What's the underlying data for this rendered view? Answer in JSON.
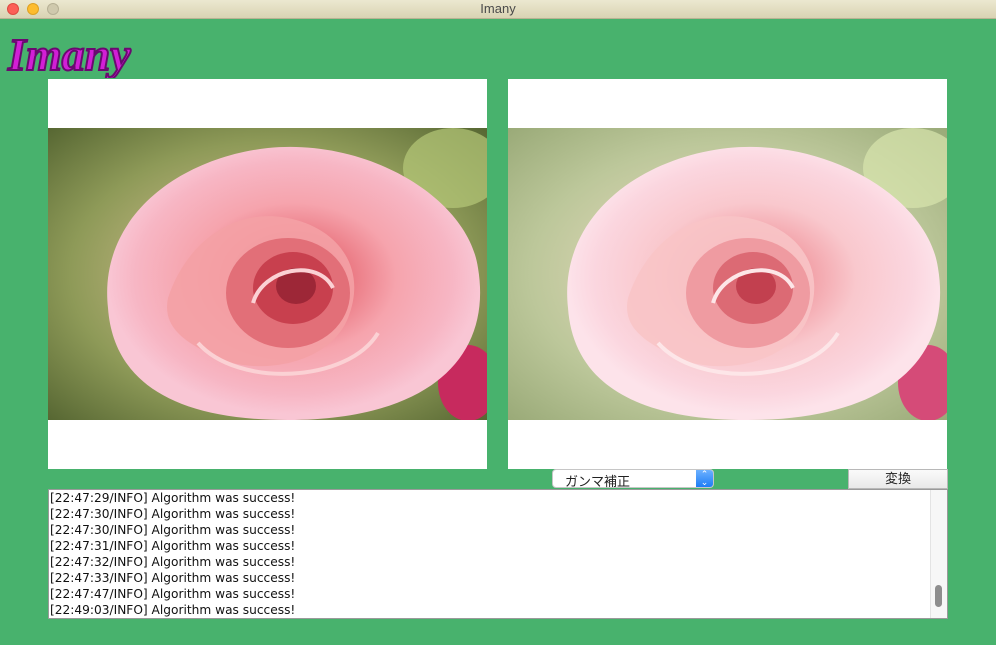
{
  "window": {
    "title": "Imany"
  },
  "logo": {
    "text": "Imany",
    "color": "#d21fd6"
  },
  "panels": {
    "original_image": {
      "description_icon": "rose-photo"
    },
    "processed_image": {
      "description_icon": "rose-photo-gamma-corrected"
    }
  },
  "controls": {
    "algorithm_select": {
      "value": "ガンマ補正"
    },
    "convert_button": {
      "label": "変換"
    }
  },
  "log": {
    "lines": [
      "[22:47:29/INFO] Algorithm was success!",
      "[22:47:30/INFO] Algorithm was success!",
      "[22:47:30/INFO] Algorithm was success!",
      "[22:47:31/INFO] Algorithm was success!",
      "[22:47:32/INFO] Algorithm was success!",
      "[22:47:33/INFO] Algorithm was success!",
      "[22:47:47/INFO] Algorithm was success!",
      "[22:49:03/INFO] Algorithm was success!"
    ]
  },
  "colors": {
    "background": "#48b26d",
    "accent": "#1f7df5"
  }
}
